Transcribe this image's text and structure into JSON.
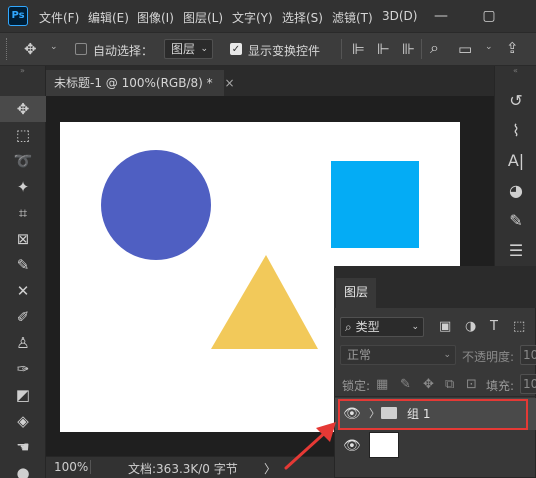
{
  "app": {
    "logo_text": "Ps"
  },
  "menu": {
    "items": [
      "文件(F)",
      "编辑(E)",
      "图像(I)",
      "图层(L)",
      "文字(Y)",
      "选择(S)",
      "滤镜(T)",
      "3D(D)"
    ]
  },
  "window_controls": {
    "minimize": "—",
    "maximize": "▢"
  },
  "options_bar": {
    "move_icon": "move-icon",
    "auto_select_label": "自动选择：",
    "auto_select_checked": false,
    "auto_select_target": "图层",
    "show_transform_label": "显示变换控件",
    "show_transform_checked": true
  },
  "document": {
    "tab_title": "未标题-1 @ 100%(RGB/8) *",
    "tab_close": "×",
    "canvas": {
      "background": "#ffffff",
      "shapes": [
        {
          "kind": "circle",
          "color": "#4f5fc2"
        },
        {
          "kind": "square",
          "color": "#04acf5"
        },
        {
          "kind": "triangle",
          "color": "#f2c95a"
        }
      ]
    }
  },
  "status_bar": {
    "zoom": "100%",
    "doc_info": "文档:363.3K/0 字节",
    "arrow": "〉"
  },
  "layers_panel": {
    "tab_label": "图层",
    "filter_label": "类型",
    "blend_mode": "正常",
    "opacity_label": "不透明度:",
    "opacity_value": "10",
    "lock_label": "锁定:",
    "fill_label": "填充:",
    "fill_value": "10",
    "layers": [
      {
        "name": "组 1",
        "type": "group",
        "visible": true,
        "selected": true
      },
      {
        "name": "",
        "type": "layer",
        "visible": true,
        "selected": false
      }
    ]
  },
  "annotation": {
    "highlight_color": "#e53935"
  },
  "colors": {
    "accent": "#31a8ff",
    "highlight": "#e53935"
  }
}
